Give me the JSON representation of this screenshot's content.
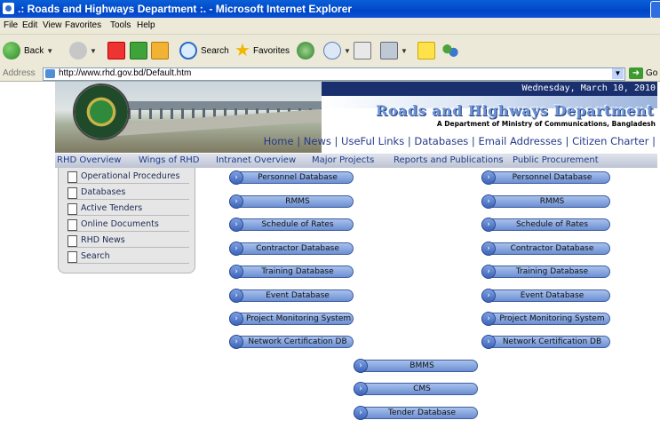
{
  "window": {
    "title": ".: Roads and Highways Department :. - Microsoft Internet Explorer"
  },
  "menu": [
    "File",
    "Edit",
    "View",
    "Favorites",
    "Tools",
    "Help"
  ],
  "toolbar": {
    "back_label": "Back",
    "search_label": "Search",
    "favorites_label": "Favorites"
  },
  "address": {
    "label": "Address",
    "url": "http://www.rhd.gov.bd/Default.htm",
    "go_label": "Go"
  },
  "banner": {
    "date": "Wednesday, March 10, 2010",
    "title": "Roads and Highways Department",
    "subtitle": "A Department of Ministry of Communications, Bangladesh",
    "links": [
      "Home",
      "News",
      "UseFul Links",
      "Databases",
      "Email Addresses",
      "Citizen Charter"
    ]
  },
  "nav": [
    "RHD Overview",
    "Wings of RHD",
    "Intranet Overview",
    "Major Projects",
    "Reports and Publications",
    "Public Procurement"
  ],
  "left_menu": [
    "Operational Procedures",
    "Databases",
    "Active Tenders",
    "Online Documents",
    "RHD News",
    "Search"
  ],
  "db_left": [
    "Personnel Database",
    "RMMS",
    "Schedule of Rates",
    "Contractor Database",
    "Training Database",
    "Event Database",
    "Project Monitoring System",
    "Network Certification DB"
  ],
  "db_right": [
    "Personnel Database",
    "RMMS",
    "Schedule of Rates",
    "Contractor Database",
    "Training Database",
    "Event Database",
    "Project Monitoring System",
    "Network Certification DB"
  ],
  "db_center": [
    "BMMS",
    "CMS",
    "Tender Database"
  ],
  "colors": {
    "titlebar": "#0046c7",
    "chrome": "#ece9d8",
    "link": "#243a8a",
    "button": "#6d8fd3"
  }
}
